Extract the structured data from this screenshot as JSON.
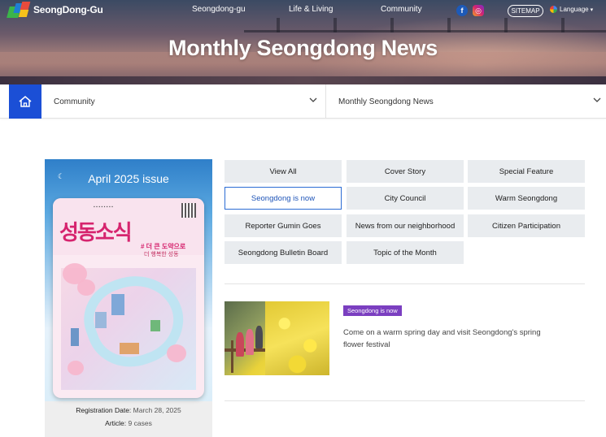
{
  "header": {
    "logo_text": "SeongDong-Gu",
    "menu": [
      "Seongdong-gu",
      "Life & Living",
      "Community"
    ],
    "sns": {
      "facebook": "f",
      "instagram": "◎"
    },
    "sitemap_label": "SITEMAP",
    "language_label": "Language",
    "page_title": "Monthly Seongdong News"
  },
  "breadcrumb": {
    "level1": "Community",
    "level2": "Monthly Seongdong News"
  },
  "cover": {
    "issue_title": "April 2025 issue",
    "magazine_title": "성동소식",
    "magazine_slogan": "# 더 큰 도약으로",
    "magazine_slogan2": "더 행복한 성동",
    "registration_label": "Registration Date:",
    "registration_value": "March 28, 2025",
    "article_label": "Article:",
    "article_value": "9 cases"
  },
  "categories": [
    {
      "label": "View All",
      "active": false
    },
    {
      "label": "Cover Story",
      "active": false
    },
    {
      "label": "Special Feature",
      "active": false
    },
    {
      "label": "Seongdong is now",
      "active": true
    },
    {
      "label": "City Council",
      "active": false
    },
    {
      "label": "Warm Seongdong",
      "active": false
    },
    {
      "label": "Reporter Gumin Goes",
      "active": false
    },
    {
      "label": "News from our neighborhood",
      "active": false
    },
    {
      "label": "Citizen Participation",
      "active": false
    },
    {
      "label": "Seongdong Bulletin Board",
      "active": false
    },
    {
      "label": "Topic of the Month",
      "active": false
    }
  ],
  "news": [
    {
      "badge": "Seongdong is now",
      "title": "Come on a warm spring day and visit Seongdong's spring flower festival"
    }
  ],
  "colors": {
    "accent": "#1b4fd6",
    "active_border": "#2b6cd4",
    "badge": "#7b3fc0",
    "category_bg": "#e9ecef"
  },
  "icons": {
    "home": "home-icon",
    "chevron": "chevron-down-icon",
    "moon": "moon-icon"
  }
}
